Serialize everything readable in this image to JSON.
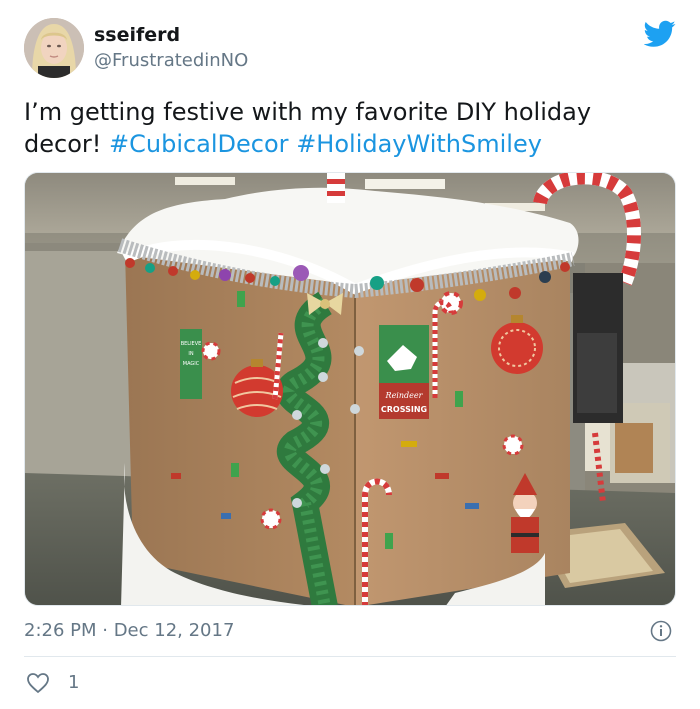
{
  "user": {
    "display_name": "sseiferd",
    "handle": "@FrustratedinNO",
    "avatar": "profile-photo"
  },
  "tweet": {
    "text_plain": "I’m getting festive with my favorite DIY holiday decor! ",
    "hashtags": [
      "#CubicalDecor",
      "#HolidayWithSmiley"
    ],
    "timestamp": "2:26 PM · Dec 12, 2017",
    "like_count": "1"
  },
  "media": {
    "description_icon": "photo",
    "sign_lines": [
      "Reindeer",
      "CROSSING"
    ],
    "small_sign_lines": [
      "BELIEVE",
      "IN",
      "MAGIC"
    ]
  },
  "icons": {
    "brand": "twitter-bird-icon",
    "info": "info-icon",
    "like": "heart-icon"
  },
  "colors": {
    "brand_blue": "#1da1f2",
    "hashtag_blue": "#1b95e0",
    "secondary_text": "#657786",
    "divider": "#e1e8ed"
  }
}
